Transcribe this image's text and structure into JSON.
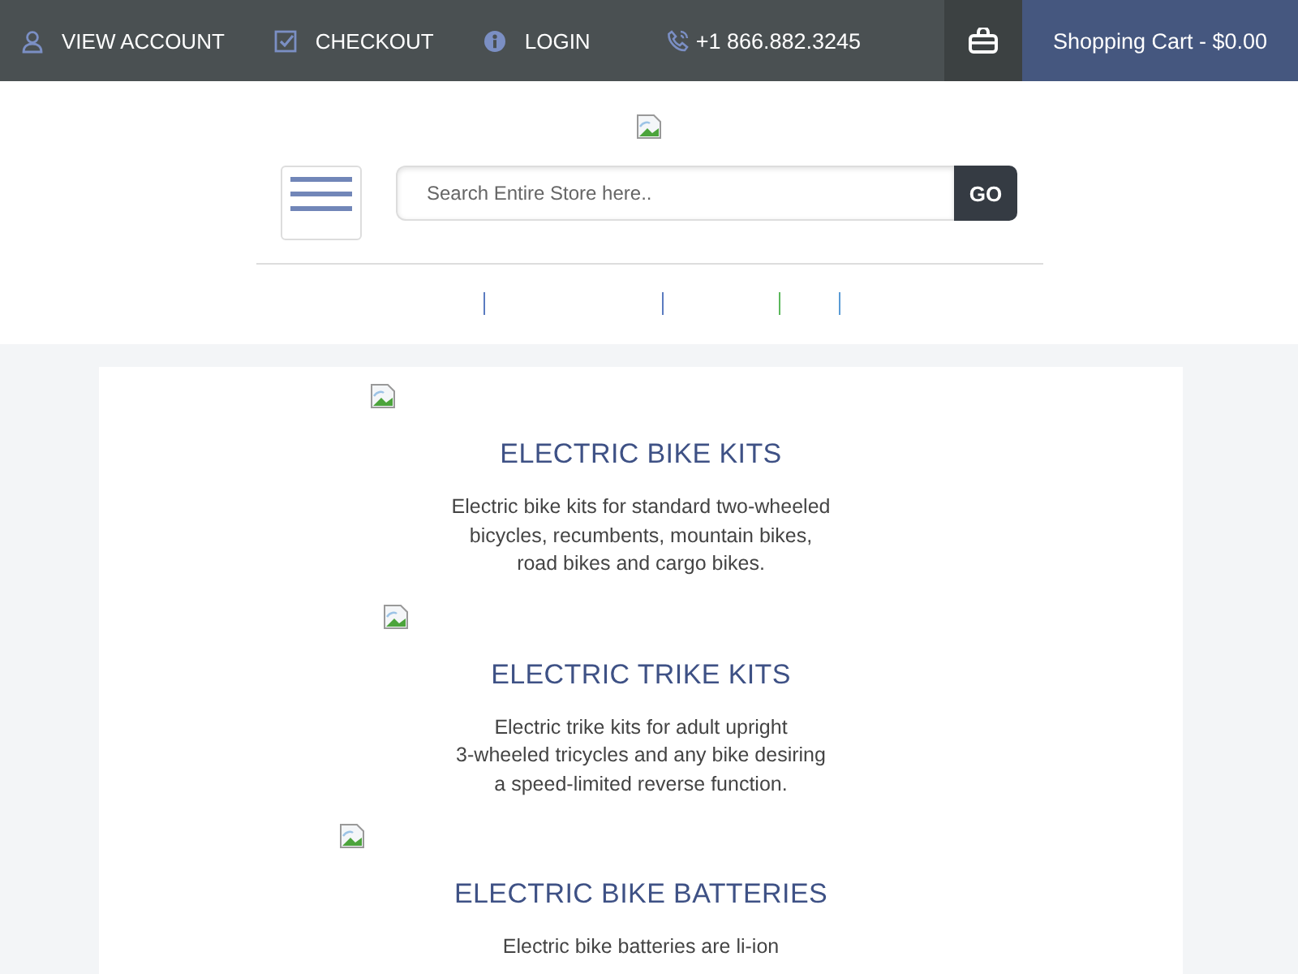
{
  "top_bar": {
    "links": [
      {
        "kind": "account",
        "label": "VIEW ACCOUNT"
      },
      {
        "kind": "checkout",
        "label": "CHECKOUT"
      },
      {
        "kind": "login",
        "label": "LOGIN"
      }
    ],
    "phone": "+1 866.882.3245",
    "cart": "Shopping Cart - $0.00"
  },
  "search": {
    "placeholder": "Search Entire Store here..",
    "button": "GO"
  },
  "nav_dividers": [
    {
      "color": "#5b7bc0"
    },
    {
      "color": "#5b7bc0"
    },
    {
      "color": "#5cb85c"
    },
    {
      "color": "#5b9bd5"
    }
  ],
  "categories": [
    {
      "title": "ELECTRIC BIKE KITS",
      "description": "Electric bike kits for standard two-wheeled\nbicycles, recumbents, mountain bikes,\nroad bikes and cargo bikes."
    },
    {
      "title": "ELECTRIC TRIKE KITS",
      "description": "Electric trike kits for adult upright\n3-wheeled tricycles and any bike desiring\na speed-limited reverse function."
    },
    {
      "title": "ELECTRIC BIKE BATTERIES",
      "description": "Electric bike batteries are li-ion"
    }
  ]
}
